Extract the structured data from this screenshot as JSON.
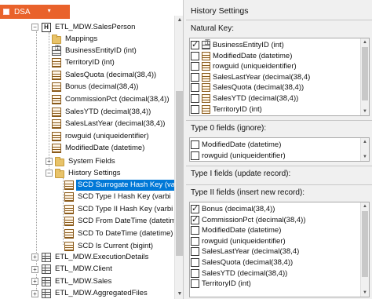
{
  "tab": {
    "label": "DSA",
    "dropdown_glyph": "▾"
  },
  "tree": {
    "parent_table": "ETL_MDW.SalesPerson",
    "mappings": "Mappings",
    "columns": [
      "BusinessEntityID (int)",
      "TerritoryID (int)",
      "SalesQuota (decimal(38,4))",
      "Bonus (decimal(38,4))",
      "CommissionPct (decimal(38,4))",
      "SalesYTD (decimal(38,4))",
      "SalesLastYear (decimal(38,4))",
      "rowguid (uniqueidentifier)",
      "ModifiedDate (datetime)"
    ],
    "system_fields": "System Fields",
    "history_settings": "History Settings",
    "history_items": [
      "SCD Surrogate Hash Key (va",
      "SCD Type I Hash Key (varbi",
      "SCD Type II Hash Key (varbi",
      "SCD From DateTime (datetim",
      "SCD To DateTime (datetime)",
      "SCD Is Current (bigint)"
    ],
    "other_tables": [
      "ETL_MDW.ExecutionDetails",
      "ETL_MDW.Client",
      "ETL_MDW.Sales",
      "ETL_MDW.AggregatedFiles"
    ]
  },
  "history": {
    "title": "History Settings",
    "natural_key_label": "Natural Key:",
    "natural_key_items": [
      {
        "label": "BusinessEntityID (int)",
        "checked": true,
        "icon": "key-column-icon"
      },
      {
        "label": "ModifiedDate (datetime)",
        "checked": false,
        "icon": "column-icon"
      },
      {
        "label": "rowguid (uniqueidentifier)",
        "checked": false,
        "icon": "column-icon"
      },
      {
        "label": "SalesLastYear (decimal(38,4)",
        "checked": false,
        "icon": "column-icon"
      },
      {
        "label": "SalesQuota (decimal(38,4))",
        "checked": false,
        "icon": "column-icon"
      },
      {
        "label": "SalesYTD (decimal(38,4))",
        "checked": false,
        "icon": "column-icon"
      },
      {
        "label": "TerritoryID (int)",
        "checked": false,
        "icon": "column-icon"
      }
    ],
    "type0_label": "Type 0 fields (ignore):",
    "type0_items": [
      {
        "label": "ModifiedDate (datetime)",
        "checked": false
      },
      {
        "label": "rowguid (uniqueidentifier)",
        "checked": false
      }
    ],
    "type1_label": "Type I fields (update record):",
    "type2_label": "Type II fields (insert new record):",
    "type2_items": [
      {
        "label": "Bonus (decimal(38,4))",
        "checked": true
      },
      {
        "label": "CommissionPct (decimal(38,4))",
        "checked": true
      },
      {
        "label": "ModifiedDate (datetime)",
        "checked": false
      },
      {
        "label": "rowguid (uniqueidentifier)",
        "checked": false
      },
      {
        "label": "SalesLastYear (decimal(38,4)",
        "checked": false
      },
      {
        "label": "SalesQuota (decimal(38,4))",
        "checked": false
      },
      {
        "label": "SalesYTD (decimal(38,4))",
        "checked": false
      },
      {
        "label": "TerritoryID (int)",
        "checked": false
      }
    ]
  }
}
